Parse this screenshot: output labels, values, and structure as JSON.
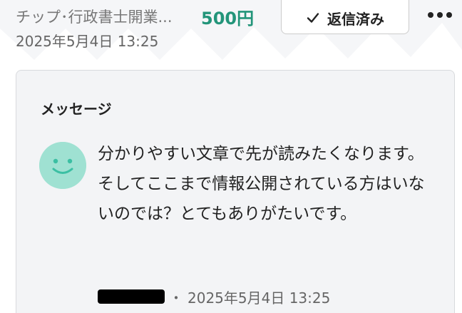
{
  "tip": {
    "title": "チップ･行政書士開業...",
    "amount": "500円",
    "date": "2025年5月4日 13:25",
    "accent_color": "#23957a"
  },
  "actions": {
    "replied_label": "返信済み",
    "replied_icon": "check-icon",
    "more_icon": "more-horizontal-icon"
  },
  "message_card": {
    "heading": "メッセージ",
    "avatar_icon": "smiley-face-icon",
    "avatar_color": "#9fe1d2",
    "paragraphs": [
      "分かりやすい文章で先が読みたくなります。",
      "そしてここまで情報公開されている方はいないのでは？とてもありがたいです。"
    ],
    "separator": "・",
    "timestamp": "2025年5月4日 13:25"
  }
}
